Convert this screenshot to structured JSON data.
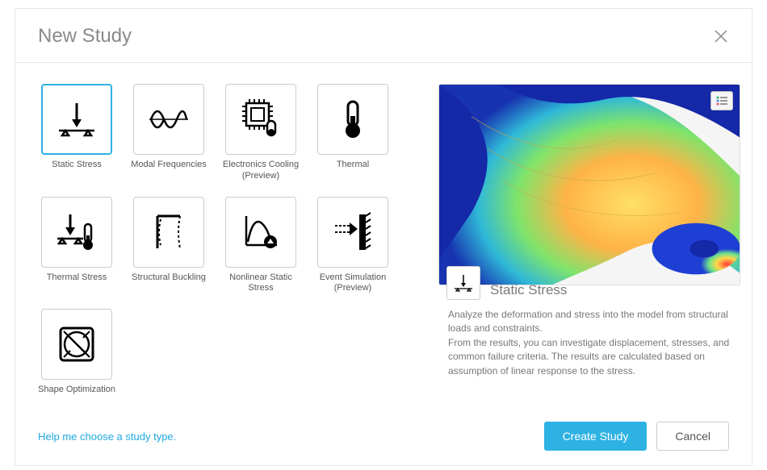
{
  "dialog": {
    "title": "New Study"
  },
  "studies": [
    {
      "id": "static-stress",
      "label": "Static Stress",
      "icon": "static-stress",
      "selected": true
    },
    {
      "id": "modal",
      "label": "Modal Frequencies",
      "icon": "modal",
      "selected": false
    },
    {
      "id": "ecooling",
      "label": "Electronics Cooling (Preview)",
      "icon": "ecooling",
      "selected": false
    },
    {
      "id": "thermal",
      "label": "Thermal",
      "icon": "thermal",
      "selected": false
    },
    {
      "id": "thermal-stress",
      "label": "Thermal Stress",
      "icon": "thermal-stress",
      "selected": false
    },
    {
      "id": "buckling",
      "label": "Structural Buckling",
      "icon": "buckling",
      "selected": false
    },
    {
      "id": "nonlinear",
      "label": "Nonlinear Static Stress",
      "icon": "nonlinear",
      "selected": false
    },
    {
      "id": "event",
      "label": "Event Simulation (Preview)",
      "icon": "event",
      "selected": false
    },
    {
      "id": "shape",
      "label": "Shape Optimization",
      "icon": "shape",
      "selected": false
    }
  ],
  "detail": {
    "title": "Static Stress",
    "description": "Analyze the deformation and stress into the model from structural loads and constraints.\nFrom the results, you can investigate displacement, stresses, and common failure criteria. The results are calculated based on assumption of linear response to the stress."
  },
  "footer": {
    "help_link": "Help me choose a study type.",
    "primary": "Create Study",
    "secondary": "Cancel"
  }
}
